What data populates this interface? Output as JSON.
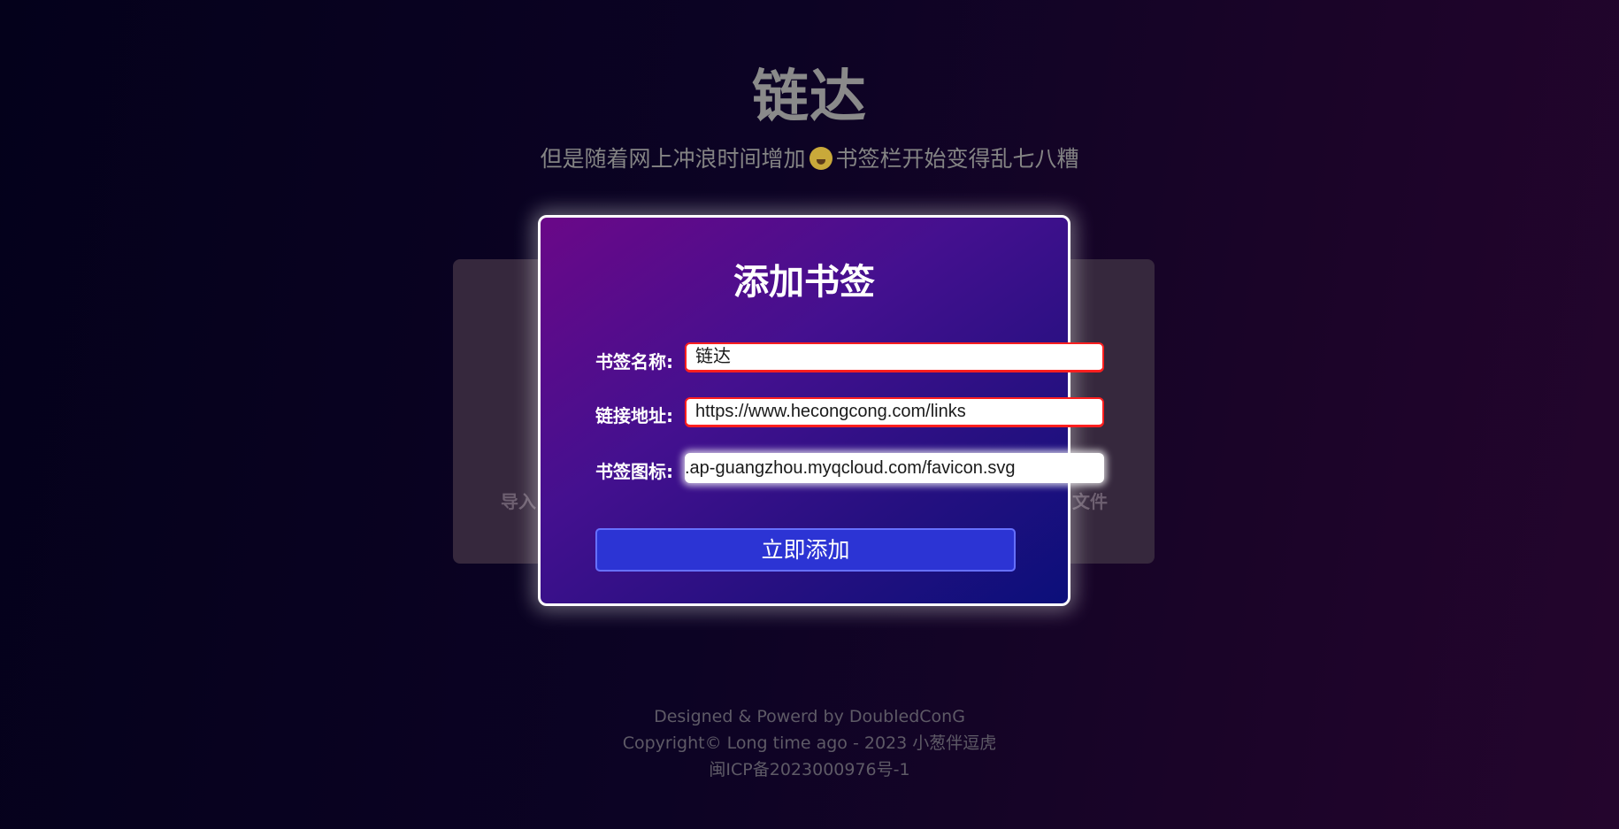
{
  "page": {
    "title": "链达",
    "subtitle_part1": "但是随着网上冲浪时间增加",
    "subtitle_emoji": "crying-face-icon",
    "subtitle_part2": "书签栏开始变得乱七八糟",
    "panel_left_text": "导入",
    "panel_right_text": "文件"
  },
  "modal": {
    "title": "添加书签",
    "name_label": "书签名称:",
    "name_value": "链达",
    "url_label": "链接地址:",
    "url_value": "https://www.hecongcong.com/links",
    "icon_label": "书签图标:",
    "icon_value": ".ap-guangzhou.myqcloud.com/favicon.svg",
    "submit_label": "立即添加"
  },
  "footer": {
    "line1": "Designed & Powerd by DoubledConG",
    "line2": "Copyright© Long time ago - 2023 小葱伴逗虎",
    "line3": "闽ICP备2023000976号-1"
  },
  "colors": {
    "modal_border": "#ffffff",
    "button_bg": "#2c34d4",
    "invalid_border": "#ff1f1f"
  }
}
